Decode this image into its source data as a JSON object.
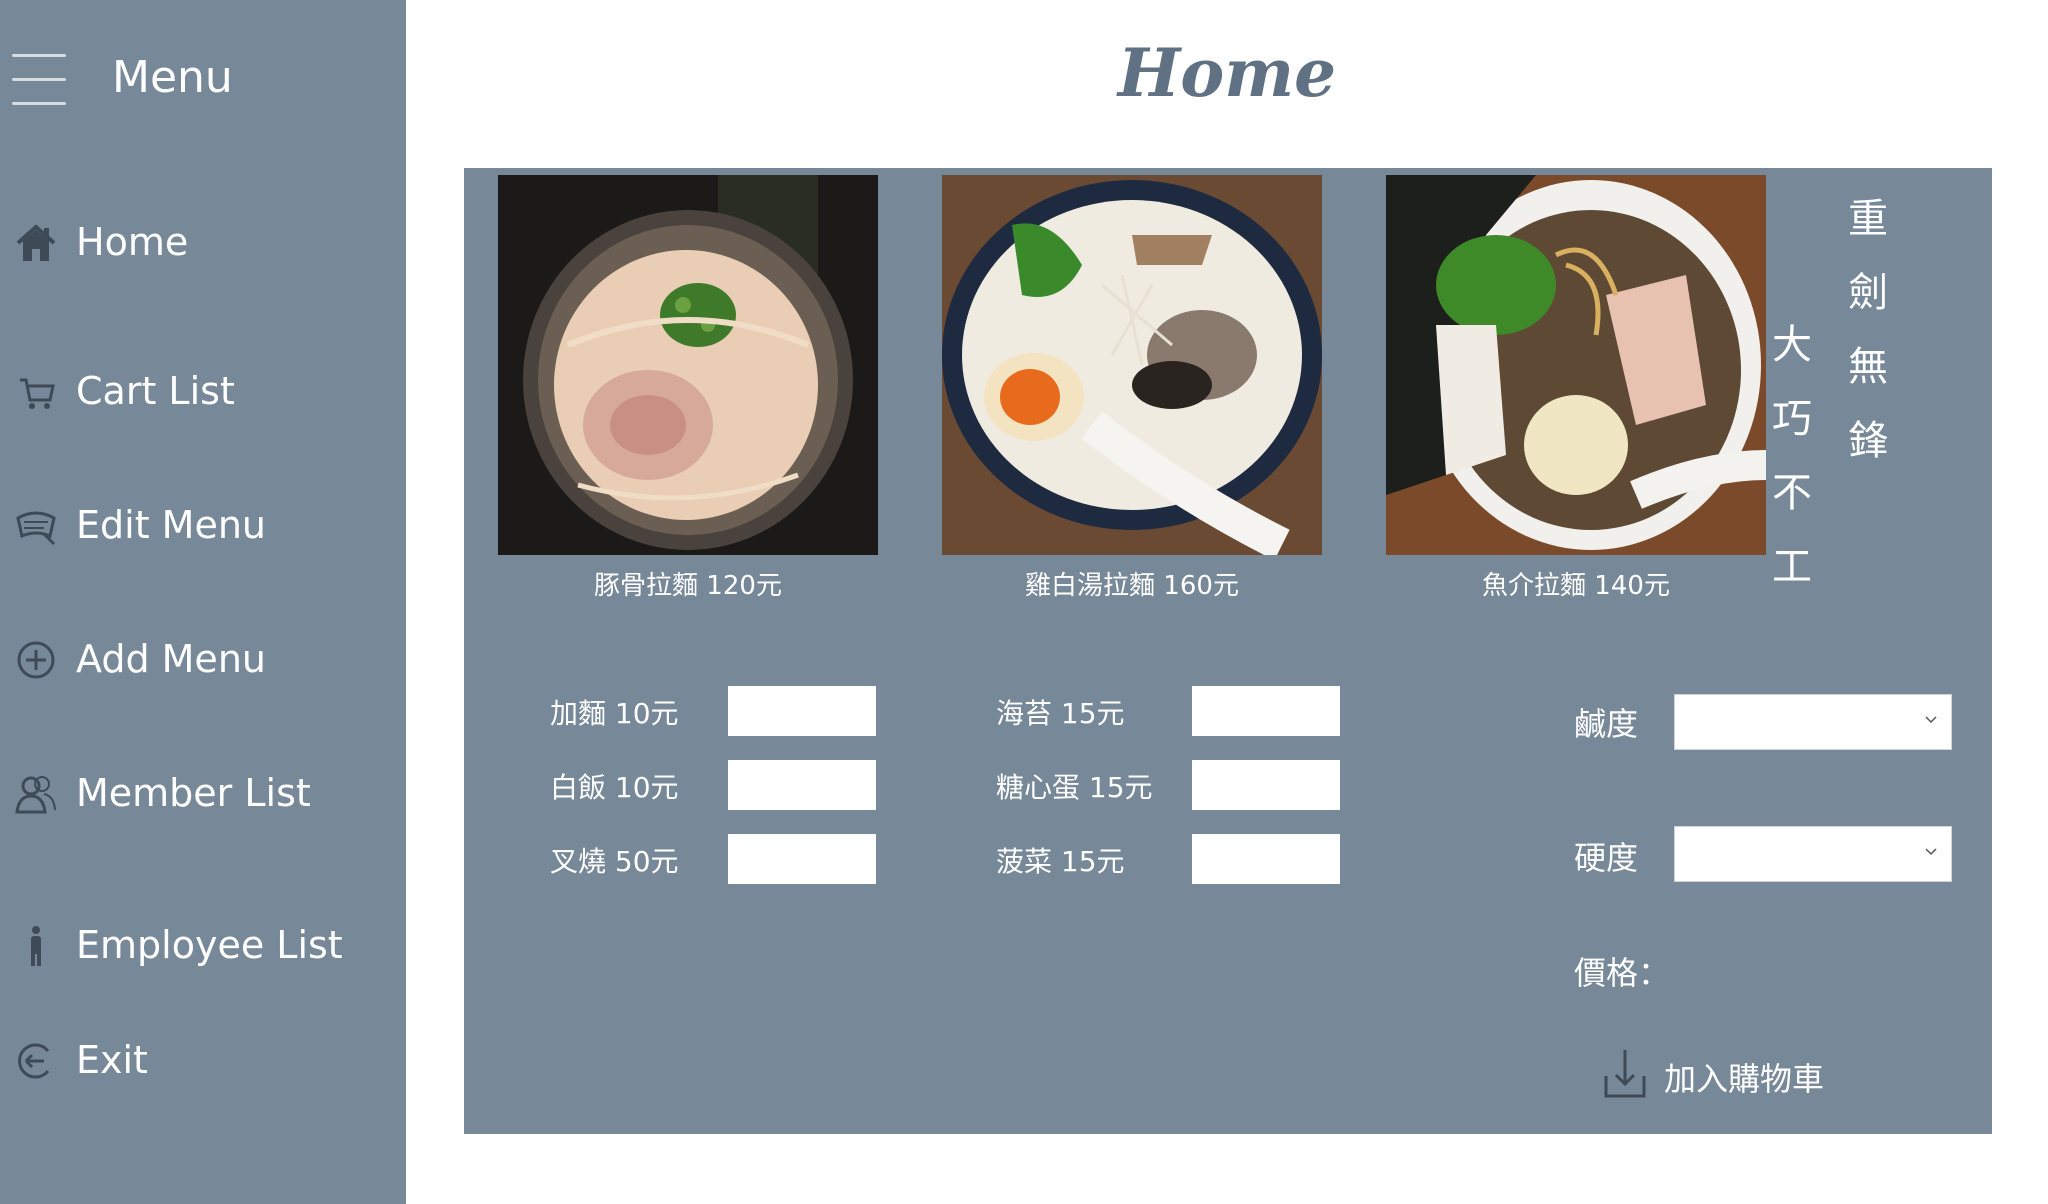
{
  "sidebar": {
    "title": "Menu",
    "items": [
      {
        "label": "Home",
        "icon": "home-icon"
      },
      {
        "label": "Cart List",
        "icon": "cart-icon"
      },
      {
        "label": "Edit Menu",
        "icon": "edit-menu-icon"
      },
      {
        "label": "Add Menu",
        "icon": "plus-circle-icon"
      },
      {
        "label": "Member List",
        "icon": "users-icon"
      },
      {
        "label": "Employee List",
        "icon": "person-icon"
      },
      {
        "label": "Exit",
        "icon": "exit-icon"
      }
    ]
  },
  "page": {
    "title": "Home"
  },
  "foods": [
    {
      "caption": "豚骨拉麵 120元"
    },
    {
      "caption": "雞白湯拉麵 160元"
    },
    {
      "caption": "魚介拉麵 140元"
    }
  ],
  "motto": {
    "col_right": "重劍無鋒",
    "col_left": "大巧不工"
  },
  "addons_left": [
    {
      "label": "加麵  10元",
      "value": ""
    },
    {
      "label": "白飯  10元",
      "value": ""
    },
    {
      "label": "叉燒  50元",
      "value": ""
    }
  ],
  "addons_right": [
    {
      "label": "海苔  15元",
      "value": ""
    },
    {
      "label": "糖心蛋  15元",
      "value": ""
    },
    {
      "label": "菠菜  15元",
      "value": ""
    }
  ],
  "options": {
    "saltiness_label": "鹹度",
    "saltiness_value": "",
    "firmness_label": "硬度",
    "firmness_value": "",
    "price_label": "價格："
  },
  "cart_button": {
    "label": "加入購物車"
  },
  "colors": {
    "sidebar_bg": "#778899",
    "panel_bg": "#778899",
    "title": "#5f7182"
  }
}
